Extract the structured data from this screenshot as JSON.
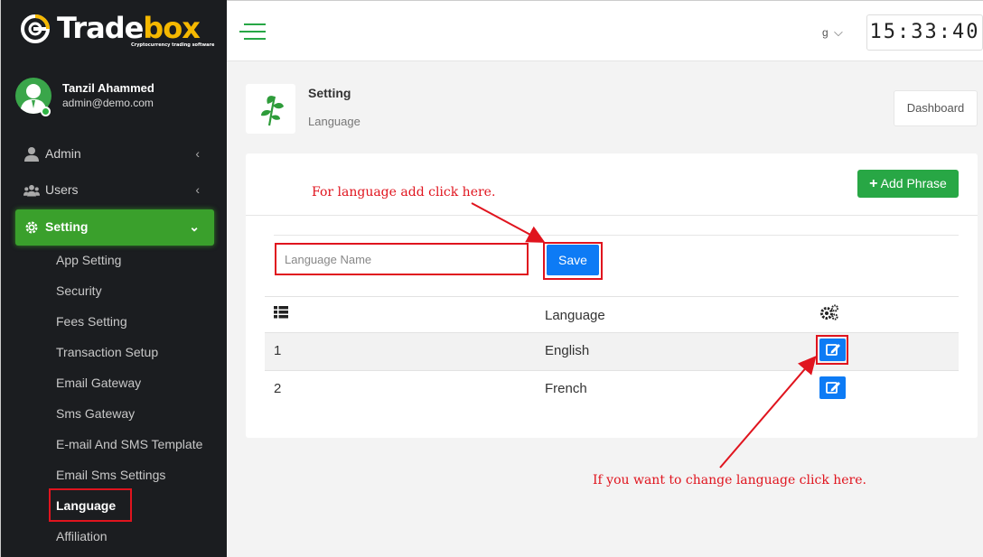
{
  "brand": {
    "name_main": "Trade",
    "name_accent": "box",
    "tagline": "Cryptocurrency trading software"
  },
  "user": {
    "name": "Tanzil Ahammed",
    "email": "admin@demo.com",
    "status": "online"
  },
  "sidebar": {
    "items": [
      {
        "label": "Admin",
        "icon": "user-tie-icon"
      },
      {
        "label": "Users",
        "icon": "users-icon"
      },
      {
        "label": "Setting",
        "icon": "gear-icon",
        "active": true
      }
    ],
    "sub_items": [
      "App Setting",
      "Security",
      "Fees Setting",
      "Transaction Setup",
      "Email Gateway",
      "Sms Gateway",
      "E-mail And SMS Template",
      "Email Sms Settings",
      "Language",
      "Affiliation"
    ],
    "current": "Language"
  },
  "header": {
    "user_menu": "g",
    "clock": "15:33:40"
  },
  "page": {
    "title": "Setting",
    "subtitle": "Language",
    "dashboard_button": "Dashboard"
  },
  "card": {
    "add_phrase_button": "Add Phrase",
    "input_placeholder": "Language Name",
    "save_button": "Save",
    "table": {
      "columns": [
        "",
        "Language",
        ""
      ],
      "rows": [
        {
          "id": "1",
          "language": "English"
        },
        {
          "id": "2",
          "language": "French"
        }
      ]
    }
  },
  "annotations": {
    "add": "For language add click here.",
    "change": "If you want to change language click here."
  },
  "colors": {
    "sidebar_bg": "#1b1d20",
    "accent_green": "#3aa02c",
    "primary_blue": "#0d7bf5",
    "annotation_red": "#e0141e"
  }
}
